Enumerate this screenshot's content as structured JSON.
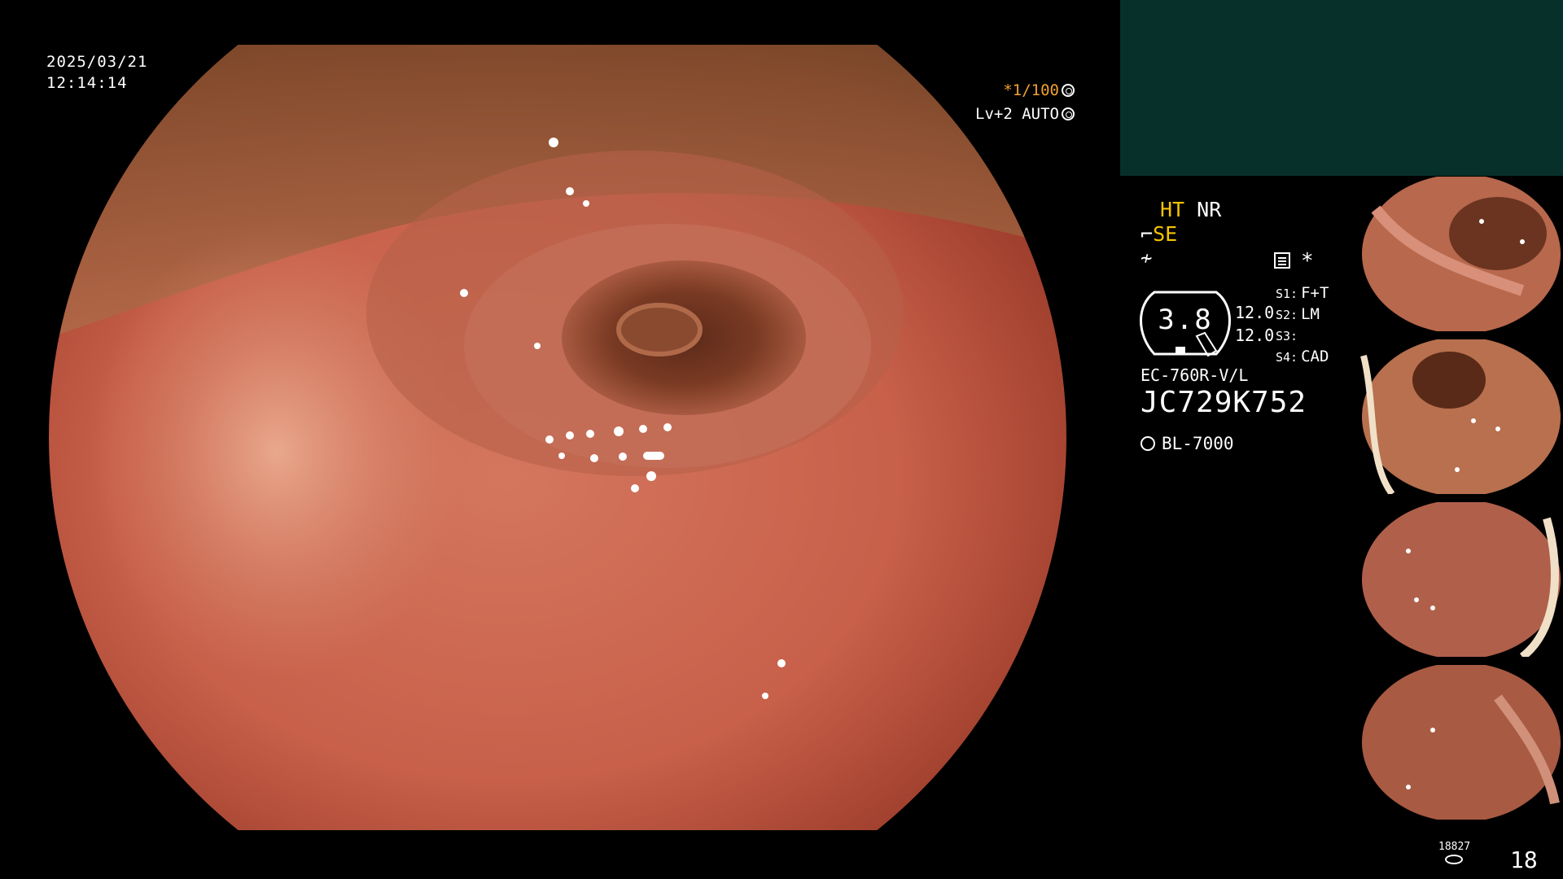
{
  "overlay": {
    "date": "2025/03/21",
    "time": "12:14:14",
    "shutter": "*1/100",
    "level": "Lv+2 AUTO"
  },
  "panel": {
    "mode_ht": "HT",
    "mode_nr": "NR",
    "mode_se": "SE",
    "gauge_value": "3.8",
    "ratio_1": "12.0",
    "ratio_2": "12.0",
    "slots": [
      {
        "key": "S1:",
        "value": "F+T"
      },
      {
        "key": "S2:",
        "value": "LM"
      },
      {
        "key": "S3:",
        "value": ""
      },
      {
        "key": "S4:",
        "value": "CAD"
      }
    ],
    "scope_model": "EC-760R-V/L",
    "serial": "JC729K752",
    "light_source": "BL-7000",
    "counter_small": "18827",
    "counter_big": "18"
  },
  "icons": {
    "shutter": "aperture-icon",
    "auto": "auto-exposure-icon",
    "light": "light-source-icon",
    "storage": "disk-icon"
  },
  "colors": {
    "background": "#000000",
    "accent_yellow": "#f5c400",
    "accent_orange": "#f0a030",
    "top_block": "#07302a",
    "text": "#ffffff"
  }
}
